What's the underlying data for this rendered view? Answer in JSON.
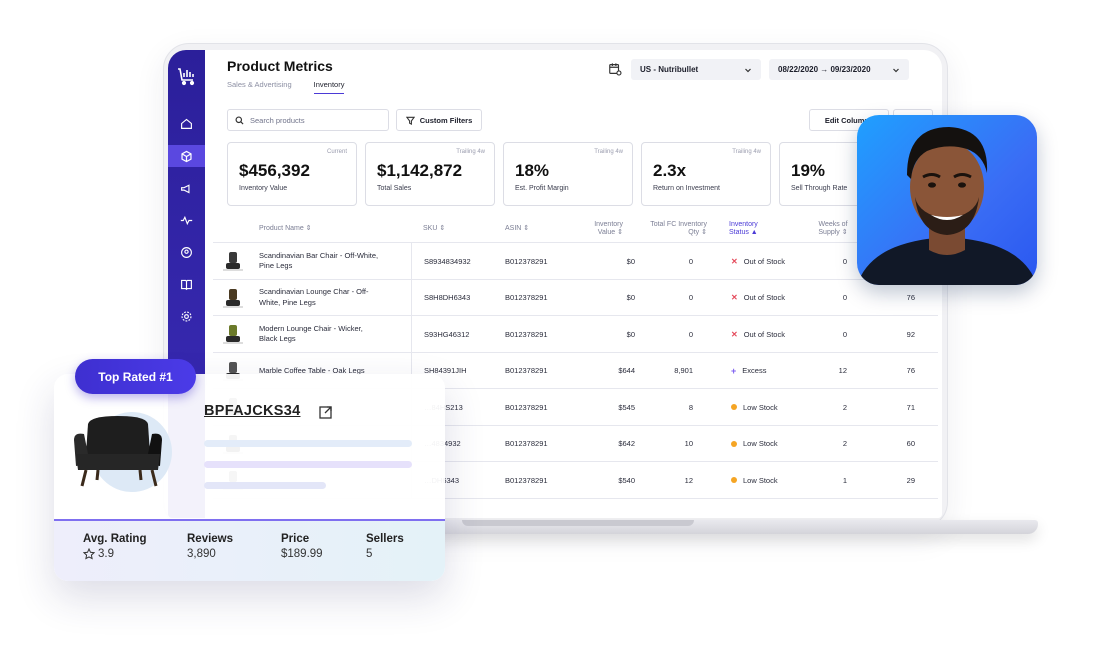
{
  "header": {
    "title": "Product Metrics",
    "tabs": [
      {
        "label": "Sales & Advertising"
      },
      {
        "label": "Inventory"
      }
    ],
    "market": "US - Nutribullet",
    "date_range": "08/22/2020 → 09/23/2020"
  },
  "toolbar": {
    "search_placeholder": "Search products",
    "filters_label": "Custom Filters",
    "edit_columns_label": "Edit Columns"
  },
  "kpis": [
    {
      "tag": "Current",
      "value": "$456,392",
      "label": "Inventory Value"
    },
    {
      "tag": "Trailing 4w",
      "value": "$1,142,872",
      "label": "Total Sales"
    },
    {
      "tag": "Trailing 4w",
      "value": "18%",
      "label": "Est. Profit Margin"
    },
    {
      "tag": "Trailing 4w",
      "value": "2.3x",
      "label": "Return on Investment"
    },
    {
      "tag": "",
      "value": "19%",
      "label": "Sell Through Rate"
    }
  ],
  "table": {
    "headers": {
      "product": "Product Name ⇕",
      "sku": "SKU ⇕",
      "asin": "ASIN ⇕",
      "value": "Inventory Value ⇕",
      "qty": "Total FC Inventory Qty ⇕",
      "status": "Inventory Status ▲",
      "weeks": "Weeks of Supply ⇕"
    },
    "rows": [
      {
        "name": "Scandinavian Bar Chair - Off-White, Pine Legs",
        "sku": "S8934834932",
        "asin": "B012378291",
        "value": "$0",
        "qty": "0",
        "status": "Out of Stock",
        "weeks": "0",
        "last": ""
      },
      {
        "name": "Scandinavian Lounge Char - Off-White, Pine Legs",
        "sku": "S8H8DH6343",
        "asin": "B012378291",
        "value": "$0",
        "qty": "0",
        "status": "Out of Stock",
        "weeks": "0",
        "last": "76"
      },
      {
        "name": "Modern Lounge Chair - Wicker, Black Legs",
        "sku": "S93HG46312",
        "asin": "B012378291",
        "value": "$0",
        "qty": "0",
        "status": "Out of Stock",
        "weeks": "0",
        "last": "92"
      },
      {
        "name": "Marble Coffee Table - Oak Legs",
        "sku": "SH84391JIH",
        "asin": "B012378291",
        "value": "$644",
        "qty": "8,901",
        "status": "Excess",
        "weeks": "12",
        "last": "76"
      },
      {
        "name": "",
        "sku": "…84HS213",
        "asin": "B012378291",
        "value": "$545",
        "qty": "8",
        "status": "Low Stock",
        "weeks": "2",
        "last": "71"
      },
      {
        "name": "",
        "sku": "…4834932",
        "asin": "B012378291",
        "value": "$642",
        "qty": "10",
        "status": "Low Stock",
        "weeks": "2",
        "last": "60"
      },
      {
        "name": "",
        "sku": "…DH6343",
        "asin": "B012378291",
        "value": "$540",
        "qty": "12",
        "status": "Low Stock",
        "weeks": "1",
        "last": "29"
      }
    ]
  },
  "product_card": {
    "badge": "Top Rated #1",
    "code": "BPFAJCKS34",
    "stats": [
      {
        "label": "Avg. Rating",
        "value": "3.9"
      },
      {
        "label": "Reviews",
        "value": "3,890"
      },
      {
        "label": "Price",
        "value": "$189.99"
      },
      {
        "label": "Sellers",
        "value": "5"
      }
    ]
  },
  "colors": {
    "brand": "#3b2cb8",
    "accent": "#4b3ad6",
    "out_of_stock": "#e4495a",
    "low_stock": "#f5a524",
    "excess": "#7b5cf0"
  }
}
